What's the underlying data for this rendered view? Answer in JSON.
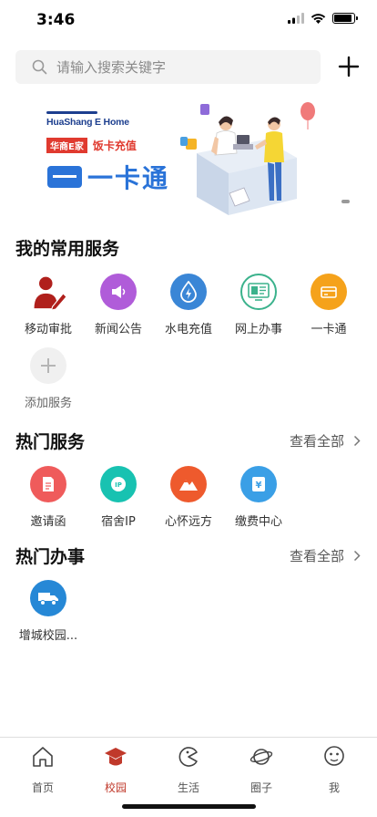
{
  "status_bar": {
    "time": "3:46"
  },
  "search": {
    "placeholder": "请输入搜索关键字"
  },
  "banner": {
    "logo_text": "HuaShang E Home",
    "tag_box": "华商E家",
    "tag_text": "饭卡充值",
    "title": "一卡通"
  },
  "common_services": {
    "title": "我的常用服务",
    "items": [
      {
        "label": "移动审批",
        "icon": "user-edit-icon",
        "color": "#b0201c"
      },
      {
        "label": "新闻公告",
        "icon": "megaphone-icon",
        "color": "#b05cd9"
      },
      {
        "label": "水电充值",
        "icon": "water-bolt-icon",
        "color": "#3a86d6"
      },
      {
        "label": "网上办事",
        "icon": "online-office-icon",
        "color": "#3bb28c"
      },
      {
        "label": "一卡通",
        "icon": "card-icon",
        "color": "#f5a21b"
      }
    ],
    "add_label": "添加服务"
  },
  "hot_services": {
    "title": "热门服务",
    "view_all": "查看全部",
    "items": [
      {
        "label": "邀请函",
        "icon": "invitation-icon",
        "color": "#ef5b5b"
      },
      {
        "label": "宿舍IP",
        "icon": "ip-icon",
        "color": "#18c2b1"
      },
      {
        "label": "心怀远方",
        "icon": "mountain-icon",
        "color": "#ee5a2d"
      },
      {
        "label": "缴费中心",
        "icon": "yen-icon",
        "color": "#3a9fe6"
      }
    ]
  },
  "hot_affairs": {
    "title": "热门办事",
    "view_all": "查看全部",
    "items": [
      {
        "label": "增城校园...",
        "icon": "truck-icon",
        "color": "#2688d6"
      }
    ]
  },
  "tabs": [
    {
      "label": "首页",
      "icon": "home-icon",
      "active": false
    },
    {
      "label": "校园",
      "icon": "campus-icon",
      "active": true
    },
    {
      "label": "生活",
      "icon": "life-icon",
      "active": false
    },
    {
      "label": "圈子",
      "icon": "planet-icon",
      "active": false
    },
    {
      "label": "我",
      "icon": "face-icon",
      "active": false
    }
  ]
}
